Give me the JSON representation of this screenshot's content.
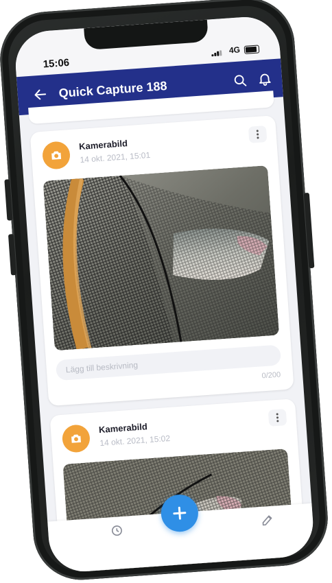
{
  "status": {
    "time": "15:06",
    "network": "4G"
  },
  "appbar": {
    "title": "Quick Capture 188"
  },
  "cards": [
    {
      "title": "Kamerabild",
      "date": "14 okt. 2021, 15:01",
      "description_placeholder": "Lägg till beskrivning",
      "char_count": "0/200"
    },
    {
      "title": "Kamerabild",
      "date": "14 okt. 2021, 15:02"
    }
  ],
  "icons": {
    "back": "arrow-left-icon",
    "search": "search-icon",
    "notifications": "bell-icon",
    "capture": "camera-icon",
    "more": "more-vertical-icon",
    "add": "plus-icon",
    "edit": "edit-icon"
  },
  "colors": {
    "appbar": "#23308a",
    "accent": "#2f8fe6",
    "avatar": "#f2a33a",
    "background": "#f1f2f6"
  }
}
